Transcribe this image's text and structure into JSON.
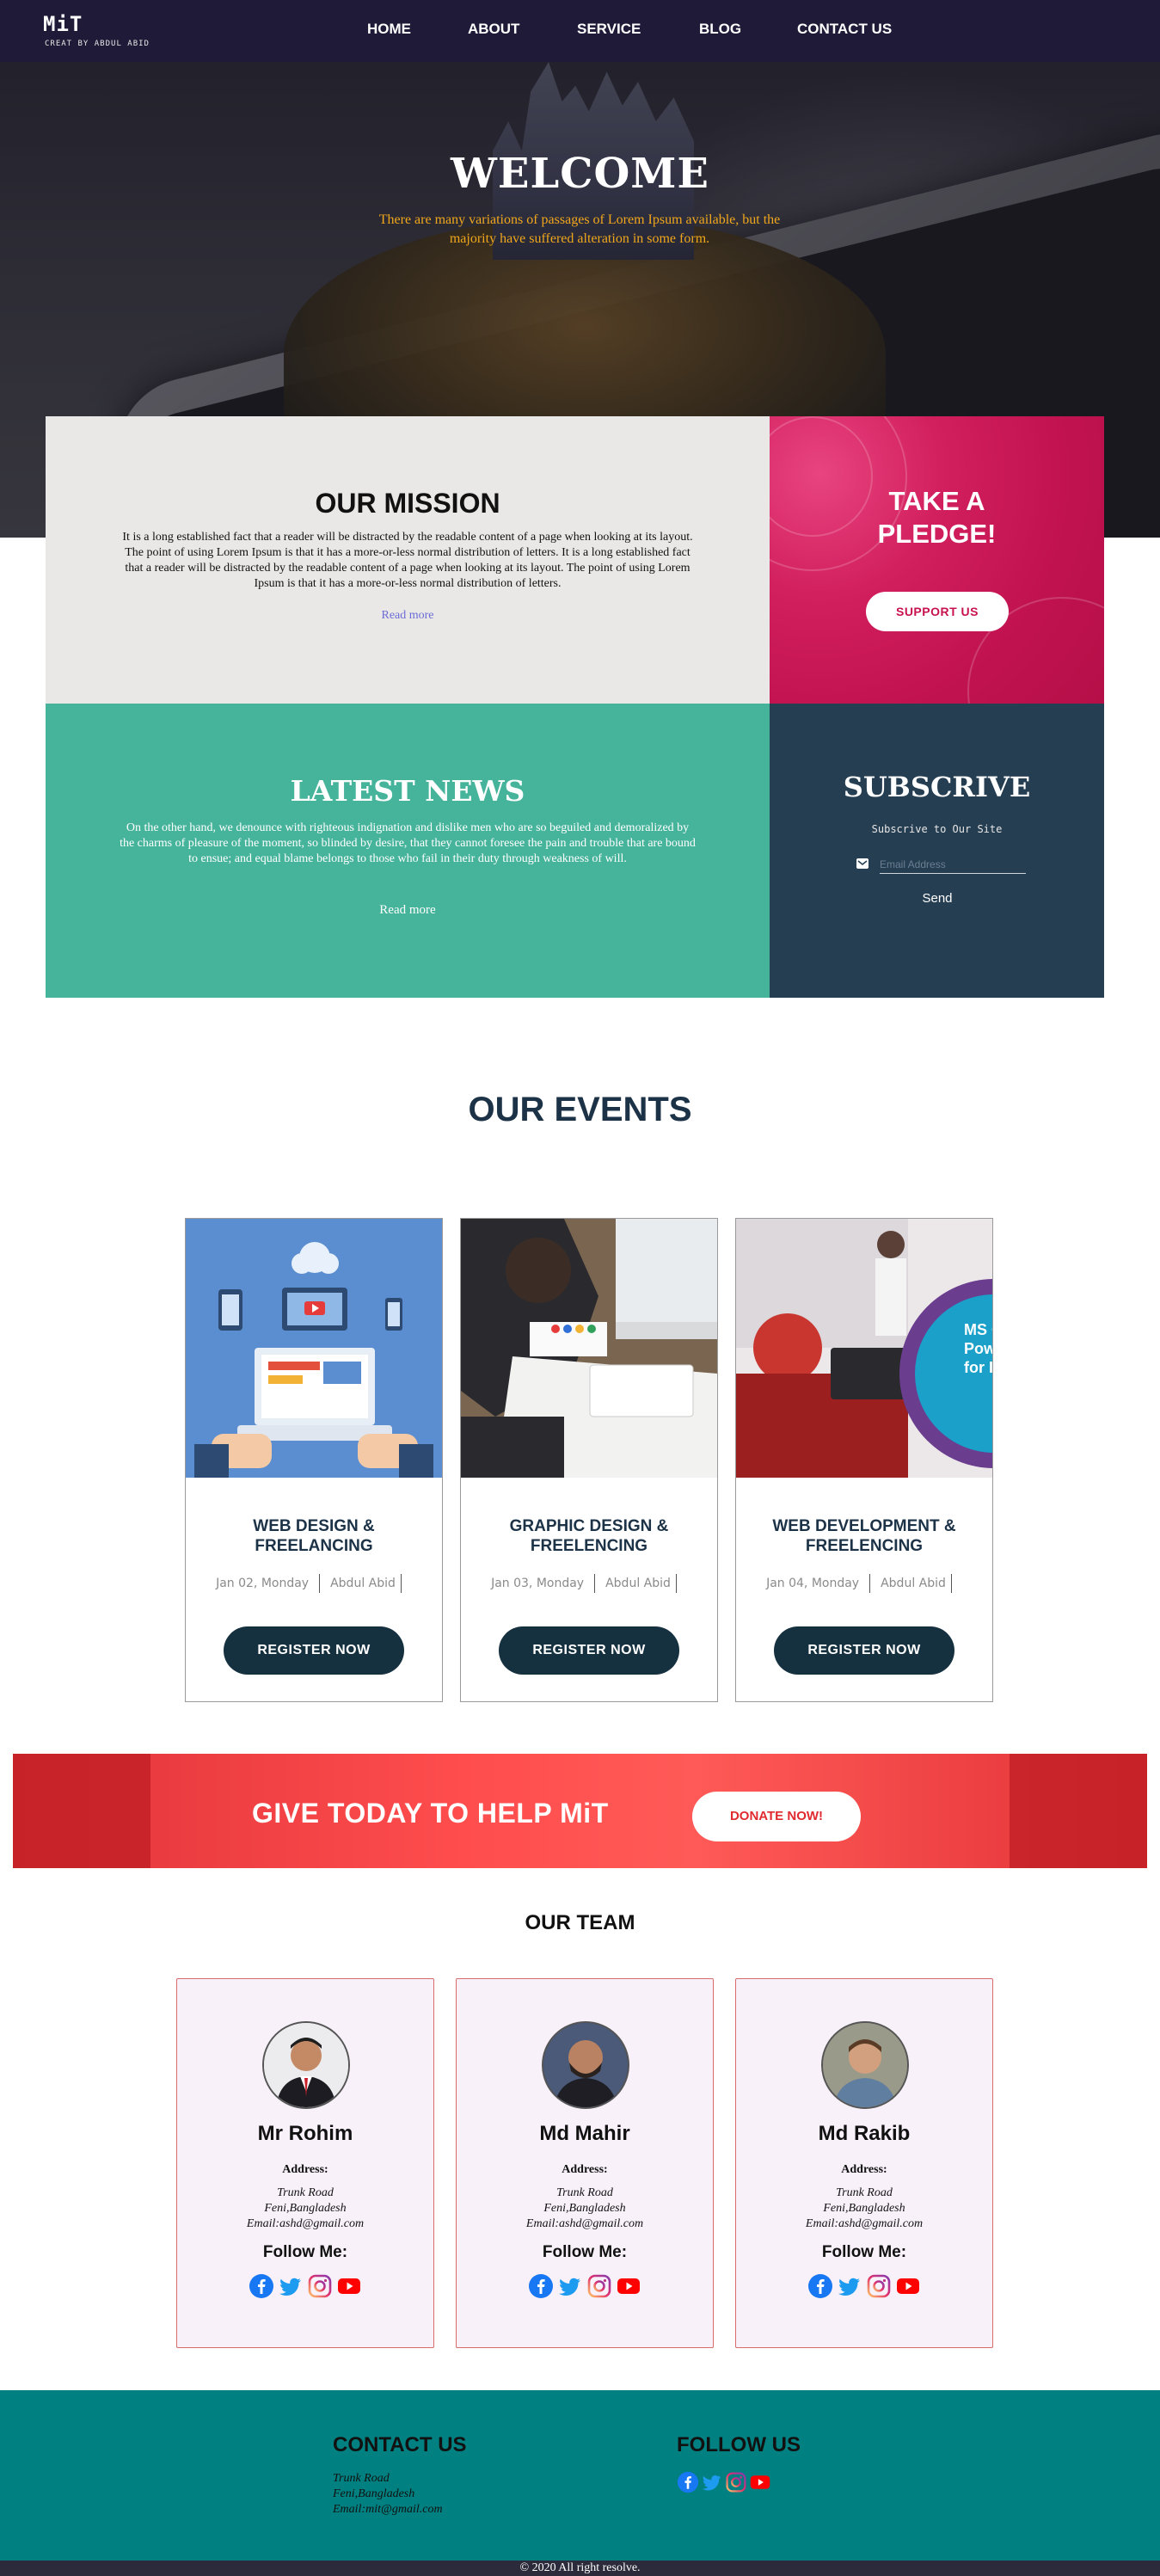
{
  "nav": {
    "logo": "MiT",
    "logo_sub": "CREAT BY ABDUL ABID",
    "items": [
      "HOME",
      "ABOUT",
      "SERVICE",
      "BLOG",
      "CONTACT US"
    ]
  },
  "hero": {
    "title": "WELCOME",
    "subtitle": "There are many variations of passages of Lorem Ipsum available, but the majority have suffered alteration in some form."
  },
  "mission": {
    "title": "OUR MISSION",
    "text": "It is a long established fact that a reader will be distracted by the readable content of a page when looking at its layout. The point of using Lorem Ipsum is that it has a more-or-less normal distribution of letters. It is a long established fact that a reader will be distracted by the readable content of a page when looking at its layout. The point of using Lorem Ipsum is that it has a more-or-less normal distribution of letters.",
    "link": "Read more"
  },
  "pledge": {
    "title_line1": "TAKE A",
    "title_line2": "PLEDGE!",
    "button": "SUPPORT US"
  },
  "news": {
    "title": "LATEST NEWS",
    "text": "On the other hand, we denounce with righteous indignation and dislike men who are so beguiled and demoralized by the charms of pleasure of the moment, so blinded by desire, that they cannot foresee the pain and trouble that are bound to ensue; and equal blame belongs to those who fail in their duty through weakness of will.",
    "link": "Read more"
  },
  "subscribe": {
    "title": "SUBSCRIVE",
    "caption": "Subscrive to Our Site",
    "placeholder": "Email Address",
    "send": "Send"
  },
  "events": {
    "title": "OUR EVENTS",
    "cards": [
      {
        "title_line1": "WEB DESIGN &",
        "title_line2": "FREELANCING",
        "date": "Jan 02, Monday",
        "author": "Abdul Abid",
        "button": "REGISTER NOW"
      },
      {
        "title_line1": "GRAPHIC DESIGN &",
        "title_line2": "FREELENCING",
        "date": "Jan 03, Monday",
        "author": "Abdul Abid",
        "button": "REGISTER NOW"
      },
      {
        "title_line1": "WEB DEVELOPMENT &",
        "title_line2": "FREELENCING",
        "date": "Jan 04, Monday",
        "author": "Abdul Abid",
        "button": "REGISTER NOW"
      }
    ],
    "card3_image_text": "MS O\nPow\nfor I"
  },
  "donate": {
    "text": "GIVE TODAY TO HELP MiT",
    "button": "DONATE NOW!"
  },
  "team": {
    "title": "OUR TEAM",
    "members": [
      {
        "name": "Mr Rohim",
        "address_label": "Address:",
        "line1": "Trunk Road",
        "line2": "Feni,Bangladesh",
        "line3": "Email:ashd@gmail.com",
        "follow": "Follow Me:"
      },
      {
        "name": "Md Mahir",
        "address_label": "Address:",
        "line1": "Trunk Road",
        "line2": "Feni,Bangladesh",
        "line3": "Email:ashd@gmail.com",
        "follow": "Follow Me:"
      },
      {
        "name": "Md Rakib",
        "address_label": "Address:",
        "line1": "Trunk Road",
        "line2": "Feni,Bangladesh",
        "line3": "Email:ashd@gmail.com",
        "follow": "Follow Me:"
      }
    ]
  },
  "footer": {
    "contact_title": "CONTACT US",
    "line1": "Trunk Road",
    "line2": "Feni,Bangladesh",
    "line3": "Email:mit@gmail.com",
    "follow_title": "FOLLOW US",
    "copyright": "© 2020 All right resolve."
  },
  "icons": [
    "facebook-icon",
    "twitter-icon",
    "instagram-icon",
    "youtube-icon",
    "mail-icon"
  ],
  "colors": {
    "nav_bg": "#1f1a37",
    "accent_orange": "#f0a71c",
    "pledge_pink": "#c8124f",
    "news_teal": "#46b39b",
    "subscribe_navy": "#263e52",
    "events_navy": "#1c3247",
    "donate_red": "#ff4d4d",
    "footer_teal": "#008080"
  }
}
